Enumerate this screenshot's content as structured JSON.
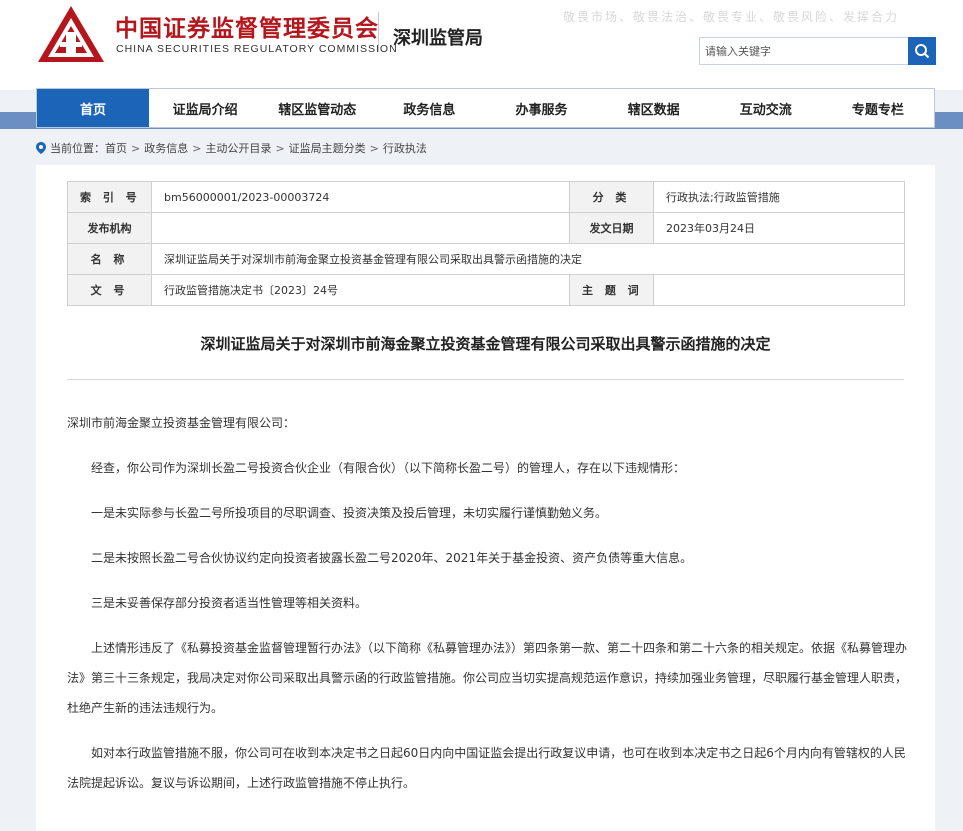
{
  "header": {
    "brand_cn": "中国证券监督管理委员会",
    "brand_en": "CHINA SECURITIES REGULATORY COMMISSION",
    "bureau": "深圳监管局",
    "slogan": "敬畏市场、敬畏法治、敬畏专业、敬畏风险、发挥合力",
    "search_placeholder": "请输入关键字",
    "logo_color": "#b4161b",
    "accent_color": "#1b64b8"
  },
  "nav": {
    "items": [
      {
        "label": "首页",
        "active": true
      },
      {
        "label": "证监局介绍"
      },
      {
        "label": "辖区监管动态"
      },
      {
        "label": "政务信息"
      },
      {
        "label": "办事服务"
      },
      {
        "label": "辖区数据"
      },
      {
        "label": "互动交流"
      },
      {
        "label": "专题专栏"
      }
    ]
  },
  "breadcrumb": {
    "label": "当前位置：",
    "items": [
      "首页",
      "政务信息",
      "主动公开目录",
      "证监局主题分类",
      "行政执法"
    ]
  },
  "meta": {
    "index_label": "索 引 号",
    "index_value": "bm56000001/2023-00003724",
    "category_label": "分 类",
    "category_value": "行政执法;行政监管措施",
    "issuer_label": "发布机构",
    "issuer_value": "",
    "date_label": "发文日期",
    "date_value": "2023年03月24日",
    "name_label": "名 称",
    "name_value": "深圳证监局关于对深圳市前海金聚立投资基金管理有限公司采取出具警示函措施的决定",
    "docno_label": "文 号",
    "docno_value": "行政监管措施决定书〔2023〕24号",
    "keywords_label": "主 题 词",
    "keywords_value": ""
  },
  "document": {
    "title": "深圳证监局关于对深圳市前海金聚立投资基金管理有限公司采取出具警示函措施的决定",
    "salutation": "深圳市前海金聚立投资基金管理有限公司：",
    "p1": "经查，你公司作为深圳长盈二号投资合伙企业（有限合伙）（以下简称长盈二号）的管理人，存在以下违规情形：",
    "p2": "一是未实际参与长盈二号所投项目的尽职调查、投资决策及投后管理，未切实履行谨慎勤勉义务。",
    "p3": "二是未按照长盈二号合伙协议约定向投资者披露长盈二号2020年、2021年关于基金投资、资产负债等重大信息。",
    "p4": "三是未妥善保存部分投资者适当性管理等相关资料。",
    "p5": "上述情形违反了《私募投资基金监督管理暂行办法》（以下简称《私募管理办法》）第四条第一款、第二十四条和第二十六条的相关规定。依据《私募管理办法》第三十三条规定，我局决定对你公司采取出具警示函的行政监管措施。你公司应当切实提高规范运作意识，持续加强业务管理，尽职履行基金管理人职责，杜绝产生新的违法违规行为。",
    "p6": "如对本行政监管措施不服，你公司可在收到本决定书之日起60日内向中国证监会提出行政复议申请，也可在收到本决定书之日起6个月内向有管辖权的人民法院提起诉讼。复议与诉讼期间，上述行政监管措施不停止执行。"
  }
}
